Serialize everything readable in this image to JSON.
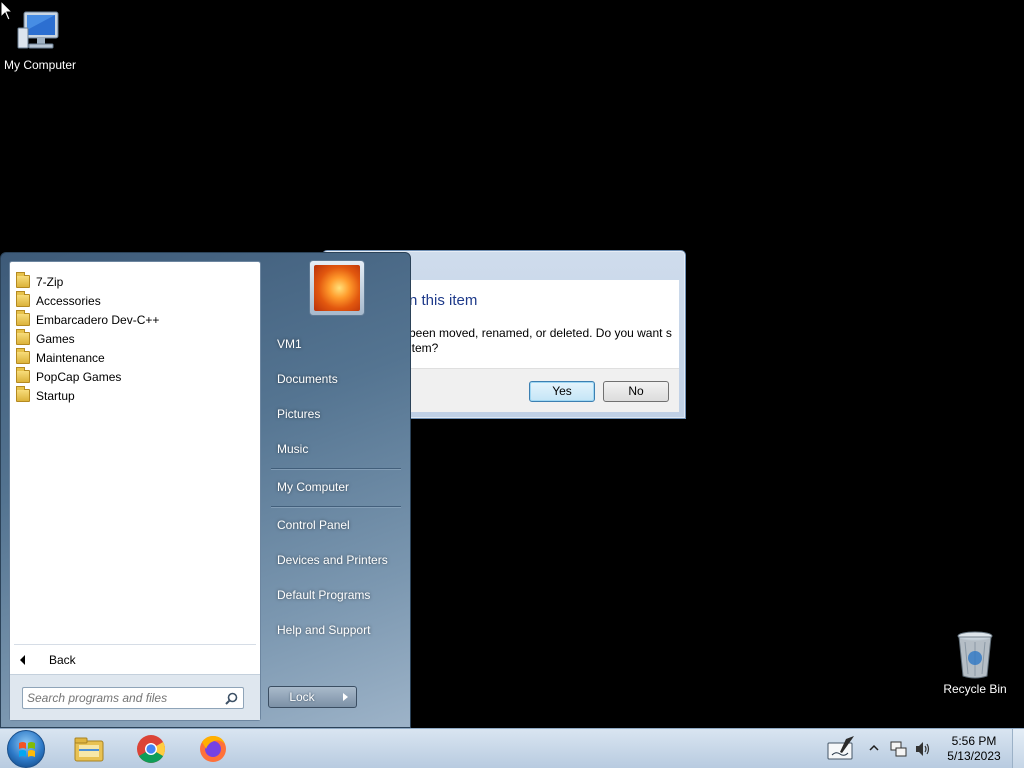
{
  "desktop": {
    "icons": [
      {
        "label": "My Computer",
        "icon": "computer-icon"
      },
      {
        "label": "Recycle Bin",
        "icon": "recycle-bin-icon"
      }
    ]
  },
  "dialog": {
    "title": "n this item",
    "message": "been moved, renamed, or deleted. Do you want s item?",
    "yes_label": "Yes",
    "no_label": "No"
  },
  "start_menu": {
    "programs": [
      {
        "label": "7-Zip",
        "icon": "folder-icon"
      },
      {
        "label": "Accessories",
        "icon": "folder-icon"
      },
      {
        "label": "Embarcadero Dev-C++",
        "icon": "folder-icon"
      },
      {
        "label": "Games",
        "icon": "folder-icon"
      },
      {
        "label": "Maintenance",
        "icon": "folder-icon"
      },
      {
        "label": "PopCap Games",
        "icon": "folder-icon"
      },
      {
        "label": "Startup",
        "icon": "folder-icon"
      }
    ],
    "back_label": "Back",
    "search_placeholder": "Search programs and files",
    "right_items": [
      {
        "label": "VM1"
      },
      {
        "label": "Documents"
      },
      {
        "label": "Pictures"
      },
      {
        "label": "Music"
      },
      {
        "label": "My Computer"
      },
      {
        "label": "Control Panel"
      },
      {
        "label": "Devices and Printers"
      },
      {
        "label": "Default Programs"
      },
      {
        "label": "Help and Support"
      }
    ],
    "lock_label": "Lock"
  },
  "taskbar": {
    "pinned": [
      {
        "name": "windows-explorer-icon"
      },
      {
        "name": "chrome-icon"
      },
      {
        "name": "firefox-icon"
      }
    ],
    "clock_time": "5:56 PM",
    "clock_date": "5/13/2023"
  },
  "colors": {
    "start_menu_dark": "#3d5a78",
    "dialog_title": "#1e3a8a",
    "taskbar": "#c8d8ea"
  }
}
